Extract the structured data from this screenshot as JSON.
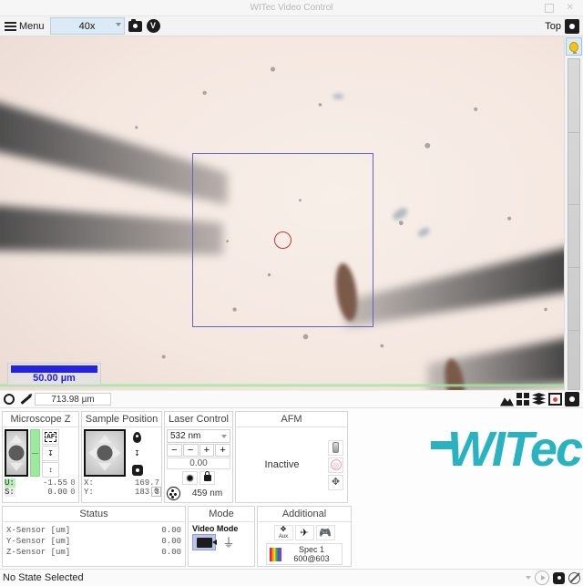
{
  "window": {
    "title": "WITec Video Control",
    "maximize_icon": "maximize-icon",
    "close_icon": "close-icon"
  },
  "toolbar": {
    "menu_label": "Menu",
    "objective": "40x",
    "camera_icon": "camera-icon",
    "video_icon": "video-check-icon",
    "top_label": "Top",
    "settings_icon": "gear-icon"
  },
  "video": {
    "scalebar_label": "50.00 µm",
    "roi_color": "#6b5fd0",
    "marker_color": "#c0392b",
    "bulb_icon": "light-bulb-icon"
  },
  "measurebar": {
    "circle_icon": "circle-tool-icon",
    "pencil_icon": "pencil-tool-icon",
    "distance_value": "713.98 µm",
    "icons": [
      "image-icon",
      "grid-icon",
      "layers-icon",
      "focus-target-icon",
      "gear-icon"
    ]
  },
  "microscope_z": {
    "title": "Microscope Z",
    "autofocus_label": "AF",
    "approach_icon": "approach-down-icon",
    "range_icon": "z-range-icon",
    "rows": [
      {
        "key": "U:",
        "value": "-1.55",
        "zero": "0",
        "highlight": true
      },
      {
        "key": "S:",
        "value": "0.00",
        "zero": "0",
        "highlight": false
      }
    ]
  },
  "sample_position": {
    "title": "Sample Position",
    "pin_icon": "map-pin-icon",
    "approach_icon": "approach-down-icon",
    "gear_icon": "gear-icon",
    "rows": [
      {
        "key": "X:",
        "value": "169.7"
      },
      {
        "key": "Y:",
        "value": "183.3"
      }
    ],
    "zero_button": "0"
  },
  "laser_control": {
    "title": "Laser Control",
    "wavelength": "532 nm",
    "buttons": [
      "−",
      "−",
      "+",
      "+"
    ],
    "power_value": "0.00",
    "laser_icon": "laser-burst-icon",
    "lock_icon": "lock-icon",
    "wheel_icon": "filter-wheel-icon",
    "secondary_wavelength": "459 nm"
  },
  "afm": {
    "title": "AFM",
    "state": "Inactive",
    "icons": [
      "cantilever-tip-icon",
      "laser-spot-icon",
      "stage-move-icon"
    ]
  },
  "status": {
    "title": "Status",
    "rows": [
      {
        "label": "X-Sensor [um]",
        "value": "0.00"
      },
      {
        "label": "Y-Sensor [um]",
        "value": "0.00"
      },
      {
        "label": "Z-Sensor [um]",
        "value": "0.00"
      }
    ]
  },
  "mode": {
    "title": "Mode",
    "subtitle": "Video Mode",
    "video_icon": "video-camera-icon",
    "spectrum_icon": "spectrum-icon"
  },
  "additional": {
    "title": "Additional",
    "aux_label": "Aux",
    "plane_icon": "airplane-icon",
    "gamepad_icon": "gamepad-icon",
    "spectrometer_icon": "spectrometer-icon",
    "spec_name": "Spec 1",
    "spec_value": "600@603"
  },
  "statusbar": {
    "text": "No State Selected",
    "play_icon": "play-icon",
    "gear_icon": "gear-icon",
    "disabled_icon": "no-entry-icon"
  },
  "brand": {
    "logo_text": "WITec",
    "color": "#29b3c0"
  }
}
